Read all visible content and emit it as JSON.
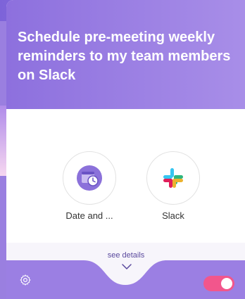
{
  "card": {
    "title": "Schedule pre-meeting weekly reminders to my team members on Slack"
  },
  "apps": [
    {
      "label": "Date and ...",
      "icon": "date-and-time-icon"
    },
    {
      "label": "Slack",
      "icon": "slack-icon"
    }
  ],
  "footer": {
    "see_details": "see details",
    "settings_icon": "gear-icon",
    "toggle_on": true
  },
  "colors": {
    "header_purple": "#8d70de",
    "toggle_pink": "#f2568c",
    "footer_purple": "#9b7fe3"
  }
}
